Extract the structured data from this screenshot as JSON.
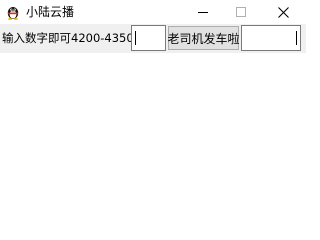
{
  "window": {
    "title": "小陆云播",
    "icon": "qq-penguin-icon"
  },
  "titlebar_buttons": {
    "minimize": "minimize-icon",
    "maximize": "maximize-icon",
    "close": "close-icon"
  },
  "toolbar": {
    "prompt_label": "输入数字即可4200-4350",
    "number_input_value": "",
    "action_button_label": "老司机发车啦",
    "text_input_value": ""
  }
}
